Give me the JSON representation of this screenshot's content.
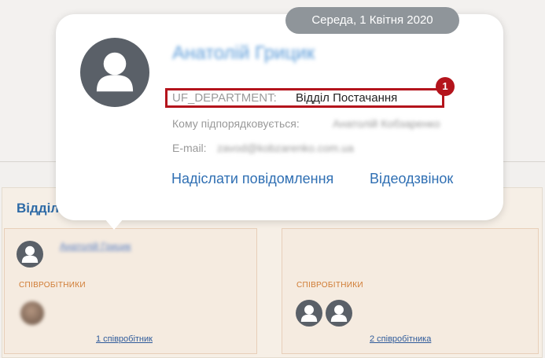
{
  "date_pill": "Середа, 1 Квітня 2020",
  "user_card": {
    "name": "Анатолій Грицик",
    "department_key": "UF_DEPARTMENT:",
    "department_value": "Відділ Постачання",
    "manager_label": "Кому підпорядковується:",
    "manager_value": "Анатолій Кобзаренко",
    "email_label": "E-mail:",
    "email_value": "zavod@kobzarenko.com.ua",
    "send_message": "Надіслати повідомлення",
    "video_call": "Відеодзвінок",
    "badge": "1"
  },
  "department": {
    "title": "Відділ",
    "left_card": {
      "head_name": "Анатолій Грицик",
      "staff_label": "СПІВРОБІТНИКИ",
      "count_link": "1 співробітник"
    },
    "right_card": {
      "staff_label": "СПІВРОБІТНИКИ",
      "count_link": "2 співробітника"
    }
  },
  "colors": {
    "accent_link": "#2f6fb3",
    "highlight_border": "#b4141c",
    "staff_label": "#d07b33"
  }
}
